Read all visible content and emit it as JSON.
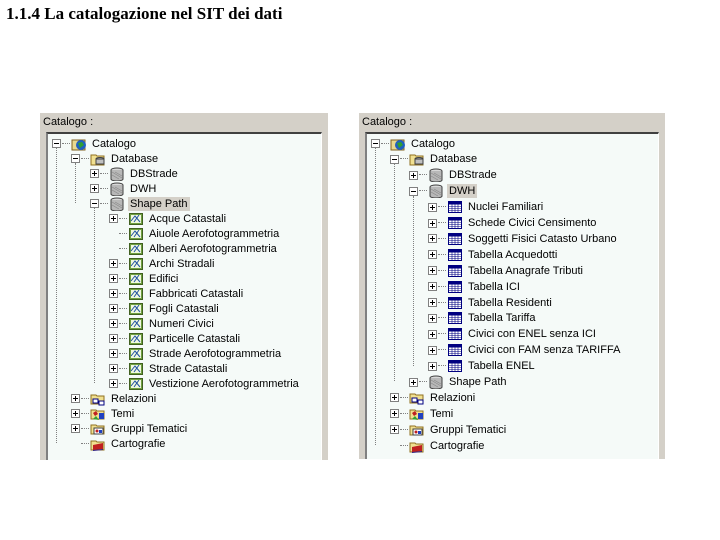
{
  "heading": "1.1.4 La catalogazione nel SIT dei dati",
  "left_panel": {
    "caption": "Catalogo :",
    "items": [
      {
        "label": "Catalogo",
        "level": 0,
        "expander": "minus",
        "icon": "catalog-icon"
      },
      {
        "label": "Database",
        "level": 1,
        "expander": "minus",
        "icon": "database-folder-icon"
      },
      {
        "label": "DBStrade",
        "level": 2,
        "expander": "plus",
        "icon": "database-icon"
      },
      {
        "label": "DWH",
        "level": 2,
        "expander": "plus",
        "icon": "database-icon"
      },
      {
        "label": "Shape Path",
        "level": 2,
        "expander": "minus",
        "icon": "database-icon",
        "selected": true
      },
      {
        "label": "Acque Catastali",
        "level": 3,
        "expander": "plus",
        "icon": "shapefile-icon"
      },
      {
        "label": "Aiuole Aerofotogrammetria",
        "level": 3,
        "expander": "none",
        "icon": "shapefile-icon"
      },
      {
        "label": "Alberi Aerofotogrammetria",
        "level": 3,
        "expander": "none",
        "icon": "shapefile-icon"
      },
      {
        "label": "Archi Stradali",
        "level": 3,
        "expander": "plus",
        "icon": "shapefile-icon"
      },
      {
        "label": "Edifici",
        "level": 3,
        "expander": "plus",
        "icon": "shapefile-icon"
      },
      {
        "label": "Fabbricati Catastali",
        "level": 3,
        "expander": "plus",
        "icon": "shapefile-icon"
      },
      {
        "label": "Fogli Catastali",
        "level": 3,
        "expander": "plus",
        "icon": "shapefile-icon"
      },
      {
        "label": "Numeri Civici",
        "level": 3,
        "expander": "plus",
        "icon": "shapefile-icon"
      },
      {
        "label": "Particelle Catastali",
        "level": 3,
        "expander": "plus",
        "icon": "shapefile-icon"
      },
      {
        "label": "Strade Aerofotogrammetria",
        "level": 3,
        "expander": "plus",
        "icon": "shapefile-icon"
      },
      {
        "label": "Strade Catastali",
        "level": 3,
        "expander": "plus",
        "icon": "shapefile-icon"
      },
      {
        "label": "Vestizione Aerofotogrammetria",
        "level": 3,
        "expander": "plus",
        "icon": "shapefile-icon"
      },
      {
        "label": "Relazioni",
        "level": 1,
        "expander": "plus",
        "icon": "relations-folder-icon"
      },
      {
        "label": "Temi",
        "level": 1,
        "expander": "plus",
        "icon": "themes-folder-icon"
      },
      {
        "label": "Gruppi Tematici",
        "level": 1,
        "expander": "plus",
        "icon": "theme-groups-folder-icon"
      },
      {
        "label": "Cartografie",
        "level": 1,
        "expander": "none",
        "icon": "maps-folder-icon"
      }
    ]
  },
  "right_panel": {
    "caption": "Catalogo :",
    "items": [
      {
        "label": "Catalogo",
        "level": 0,
        "expander": "minus",
        "icon": "catalog-icon"
      },
      {
        "label": "Database",
        "level": 1,
        "expander": "minus",
        "icon": "database-folder-icon"
      },
      {
        "label": "DBStrade",
        "level": 2,
        "expander": "plus",
        "icon": "database-icon"
      },
      {
        "label": "DWH",
        "level": 2,
        "expander": "minus",
        "icon": "database-icon",
        "selected": true
      },
      {
        "label": "Nuclei Familiari",
        "level": 3,
        "expander": "plus",
        "icon": "table-icon"
      },
      {
        "label": "Schede Civici Censimento",
        "level": 3,
        "expander": "plus",
        "icon": "table-icon"
      },
      {
        "label": "Soggetti Fisici Catasto Urbano",
        "level": 3,
        "expander": "plus",
        "icon": "table-icon"
      },
      {
        "label": "Tabella Acquedotti",
        "level": 3,
        "expander": "plus",
        "icon": "table-icon"
      },
      {
        "label": "Tabella Anagrafe Tributi",
        "level": 3,
        "expander": "plus",
        "icon": "table-icon"
      },
      {
        "label": "Tabella ICI",
        "level": 3,
        "expander": "plus",
        "icon": "table-icon"
      },
      {
        "label": "Tabella Residenti",
        "level": 3,
        "expander": "plus",
        "icon": "table-icon"
      },
      {
        "label": "Tabella Tariffa",
        "level": 3,
        "expander": "plus",
        "icon": "table-icon"
      },
      {
        "label": "Civici con ENEL senza ICI",
        "level": 3,
        "expander": "plus",
        "icon": "table-icon"
      },
      {
        "label": "Civici con FAM senza TARIFFA",
        "level": 3,
        "expander": "plus",
        "icon": "table-icon"
      },
      {
        "label": "Tabella ENEL",
        "level": 3,
        "expander": "plus",
        "icon": "table-icon"
      },
      {
        "label": "Shape Path",
        "level": 2,
        "expander": "plus",
        "icon": "database-icon"
      },
      {
        "label": "Relazioni",
        "level": 1,
        "expander": "plus",
        "icon": "relations-folder-icon"
      },
      {
        "label": "Temi",
        "level": 1,
        "expander": "plus",
        "icon": "themes-folder-icon"
      },
      {
        "label": "Gruppi Tematici",
        "level": 1,
        "expander": "plus",
        "icon": "theme-groups-folder-icon"
      },
      {
        "label": "Cartografie",
        "level": 1,
        "expander": "none",
        "icon": "maps-folder-icon"
      }
    ]
  }
}
